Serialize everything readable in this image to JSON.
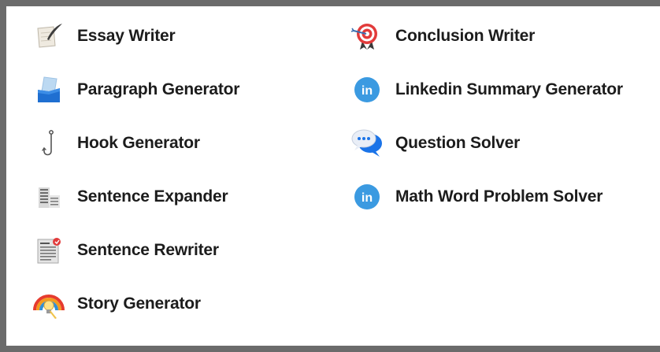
{
  "tools": {
    "left": [
      {
        "label": "Essay Writer",
        "icon": "quill-page-icon"
      },
      {
        "label": "Paragraph Generator",
        "icon": "folder-page-icon"
      },
      {
        "label": "Hook Generator",
        "icon": "hook-icon"
      },
      {
        "label": "Sentence Expander",
        "icon": "document-lines-icon"
      },
      {
        "label": "Sentence Rewriter",
        "icon": "newspaper-pen-icon"
      },
      {
        "label": "Story Generator",
        "icon": "rainbow-lightbulb-icon"
      }
    ],
    "right": [
      {
        "label": "Conclusion Writer",
        "icon": "target-arrow-icon"
      },
      {
        "label": "Linkedin Summary Generator",
        "icon": "linkedin-icon"
      },
      {
        "label": "Question Solver",
        "icon": "speech-bubbles-icon"
      },
      {
        "label": "Math Word Problem Solver",
        "icon": "linkedin-icon"
      }
    ]
  },
  "colors": {
    "border": "#6b6b6b",
    "background": "#ffffff",
    "text": "#1c1c1c",
    "linkedin_blue": "#2f8fd6",
    "bubble_blue": "#3a86ff"
  }
}
